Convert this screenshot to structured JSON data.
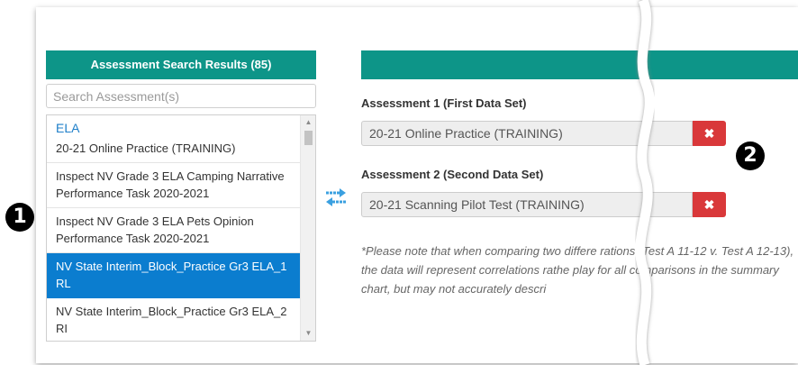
{
  "left_panel": {
    "header": "Assessment Search Results (85)",
    "search_placeholder": "Search Assessment(s)",
    "group_label": "ELA",
    "items": [
      {
        "label": "20-21 Online Practice (TRAINING)"
      },
      {
        "label": "Inspect NV Grade 3 ELA Camping Narrative Performance Task 2020-2021"
      },
      {
        "label": "Inspect NV Grade 3 ELA Pets Opinion Performance Task 2020-2021"
      },
      {
        "label": "NV State Interim_Block_Practice Gr3 ELA_1 RL"
      },
      {
        "label": "NV State Interim_Block_Practice Gr3 ELA_2 RI"
      }
    ],
    "selected_index": 3
  },
  "markers": {
    "one": "1",
    "two": "2"
  },
  "right_panel": {
    "assessment1_label": "Assessment 1 (First Data Set)",
    "assessment1_value": "20-21 Online Practice (TRAINING)",
    "assessment2_label": "Assessment 2 (Second Data Set)",
    "assessment2_value": "20-21 Scanning Pilot Test (TRAINING)",
    "clear_symbol": "✖",
    "note": "*Please note that when comparing two differe    rations (Test A 11-12 v. Test A 12-13), the data will represent correlations rathe    play for all comparisons in the summary chart, but may not accurately descri"
  },
  "icons": {
    "swap": "swap-arrows-icon",
    "close": "close-icon"
  },
  "colors": {
    "header_teal": "#0d9588",
    "selected_blue": "#0b7dcf",
    "clear_red": "#d9383a",
    "group_blue": "#1e7fc9"
  }
}
